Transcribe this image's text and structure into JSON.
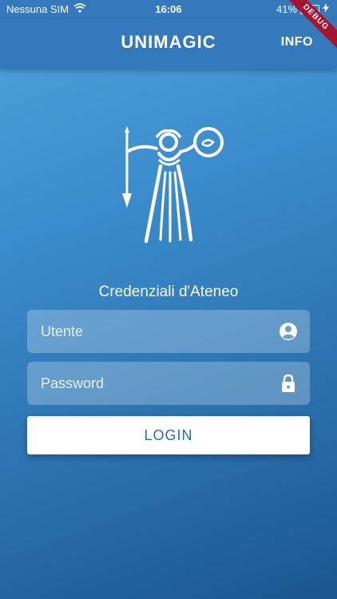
{
  "statusbar": {
    "carrier": "Nessuna SIM",
    "time": "16:06",
    "battery_percent": "41%",
    "battery_level": 0.41,
    "icons": [
      "wifi-icon",
      "battery-icon",
      "charging-icon"
    ]
  },
  "appbar": {
    "title": "UNIMAGIC",
    "info_label": "INFO",
    "debug_label": "DEBUG"
  },
  "login": {
    "section_title": "Credenziali d'Ateneo",
    "username_placeholder": "Utente",
    "username_value": "",
    "password_placeholder": "Password",
    "password_value": "",
    "button_label": "LOGIN"
  },
  "colors": {
    "appbar": "#3579bd",
    "gradient_top": "#4fa3dd",
    "gradient_bottom": "#1a5690",
    "button_text": "#2a70ad",
    "debug_ribbon": "#a3152f"
  }
}
